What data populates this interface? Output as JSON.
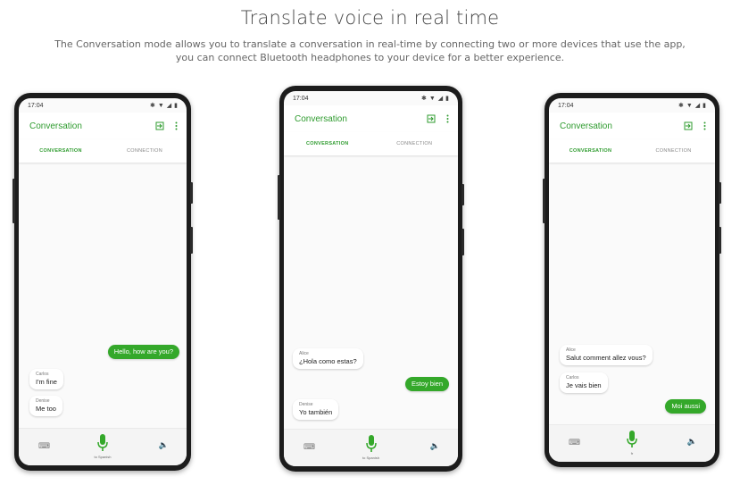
{
  "header": {
    "title": "Translate voice in real time",
    "description_line1": "The Conversation mode allows you to translate a conversation in real-time by connecting two or more devices that use the app,",
    "description_line2": "you can connect Bluetooth headphones to your device for a better experience."
  },
  "colors": {
    "accent": "#2e9b2e",
    "bubble_out": "#34a82a"
  },
  "phones": [
    {
      "time": "17:04",
      "app_title": "Conversation",
      "tabs": [
        "CONVERSATION",
        "CONNECTION"
      ],
      "mic_label": "to Spanish",
      "messages": [
        {
          "dir": "out",
          "text": "Hello, how are you?"
        },
        {
          "dir": "in",
          "sender": "Carlos",
          "text": "I'm fine"
        },
        {
          "dir": "in",
          "sender": "Denise",
          "text": "Me too"
        }
      ]
    },
    {
      "time": "17:04",
      "app_title": "Conversation",
      "tabs": [
        "CONVERSATION",
        "CONNECTION"
      ],
      "mic_label": "to Spanish",
      "messages": [
        {
          "dir": "in",
          "sender": "Alice",
          "text": "¿Hola como estas?"
        },
        {
          "dir": "out",
          "text": "Estoy bien"
        },
        {
          "dir": "in",
          "sender": "Denise",
          "text": "Yo también"
        }
      ]
    },
    {
      "time": "17:04",
      "app_title": "Conversation",
      "tabs": [
        "CONVERSATION",
        "CONNECTION"
      ],
      "mic_label": "fr",
      "messages": [
        {
          "dir": "in",
          "sender": "Alice",
          "text": "Salut comment allez vous?"
        },
        {
          "dir": "in",
          "sender": "Carlos",
          "text": "Je vais bien"
        },
        {
          "dir": "out",
          "text": "Moi aussi"
        }
      ]
    }
  ]
}
